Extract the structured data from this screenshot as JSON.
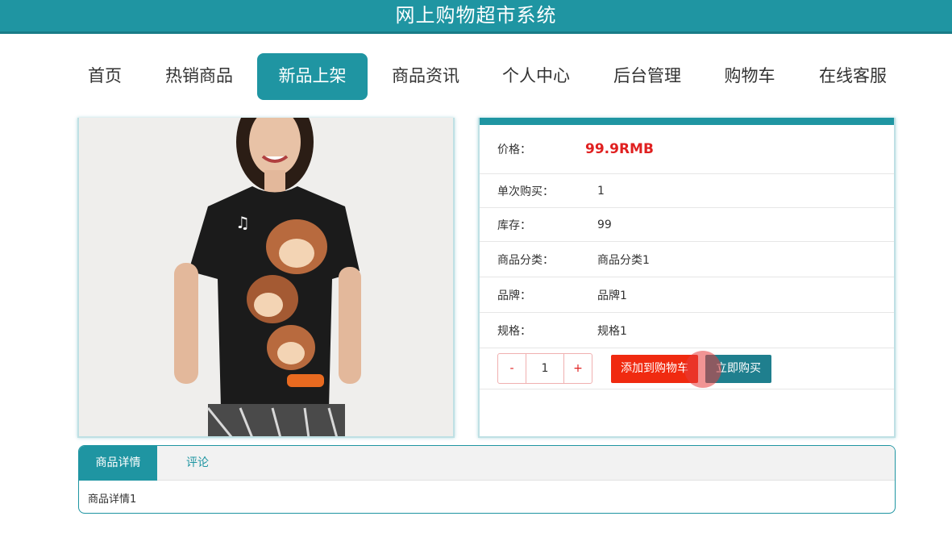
{
  "header": {
    "title": "网上购物超市系统"
  },
  "nav": {
    "items": [
      "首页",
      "热销商品",
      "新品上架",
      "商品资讯",
      "个人中心",
      "后台管理",
      "购物车",
      "在线客服"
    ],
    "active_index": 2
  },
  "product": {
    "price_label": "价格：",
    "price_value": "99.9RMB",
    "single_label": "单次购买：",
    "single_value": "1",
    "stock_label": "库存：",
    "stock_value": "99",
    "category_label": "商品分类：",
    "category_value": "商品分类1",
    "brand_label": "品牌：",
    "brand_value": "品牌1",
    "spec_label": "规格：",
    "spec_value": "规格1",
    "qty_minus": "-",
    "qty_value": "1",
    "qty_plus": "+",
    "add_cart_label": "添加到购物车",
    "buy_now_label": "立即购买"
  },
  "tabs": {
    "items": [
      "商品详情",
      "评论"
    ],
    "active_content": "商品详情1"
  },
  "colors": {
    "primary": "#1f95a2",
    "price": "#e02020",
    "cart_button": "#f02a10",
    "buy_button": "#1f7f8e"
  }
}
